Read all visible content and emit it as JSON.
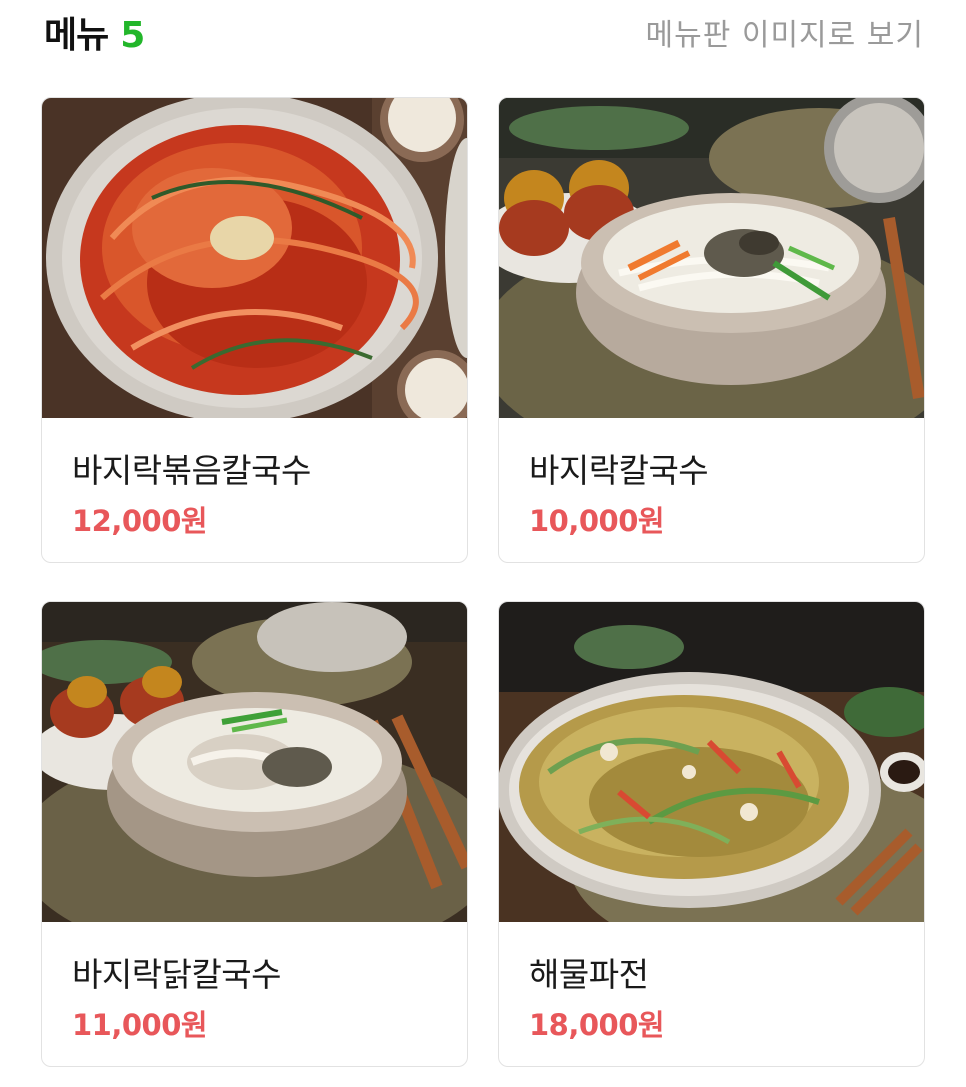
{
  "header": {
    "title": "메뉴",
    "count": "5",
    "view_image_link": "메뉴판 이미지로 보기"
  },
  "menu_items": [
    {
      "name": "바지락볶음칼국수",
      "price": "12,000원",
      "photo": "spicy-stir-fried-noodles-photo"
    },
    {
      "name": "바지락칼국수",
      "price": "10,000원",
      "photo": "clam-noodle-soup-photo"
    },
    {
      "name": "바지락닭칼국수",
      "price": "11,000원",
      "photo": "clam-chicken-noodle-soup-photo"
    },
    {
      "name": "해물파전",
      "price": "18,000원",
      "photo": "seafood-pancake-photo"
    }
  ],
  "colors": {
    "accent_count": "#22b62a",
    "price": "#e8575a",
    "link": "#9a9a9a"
  }
}
